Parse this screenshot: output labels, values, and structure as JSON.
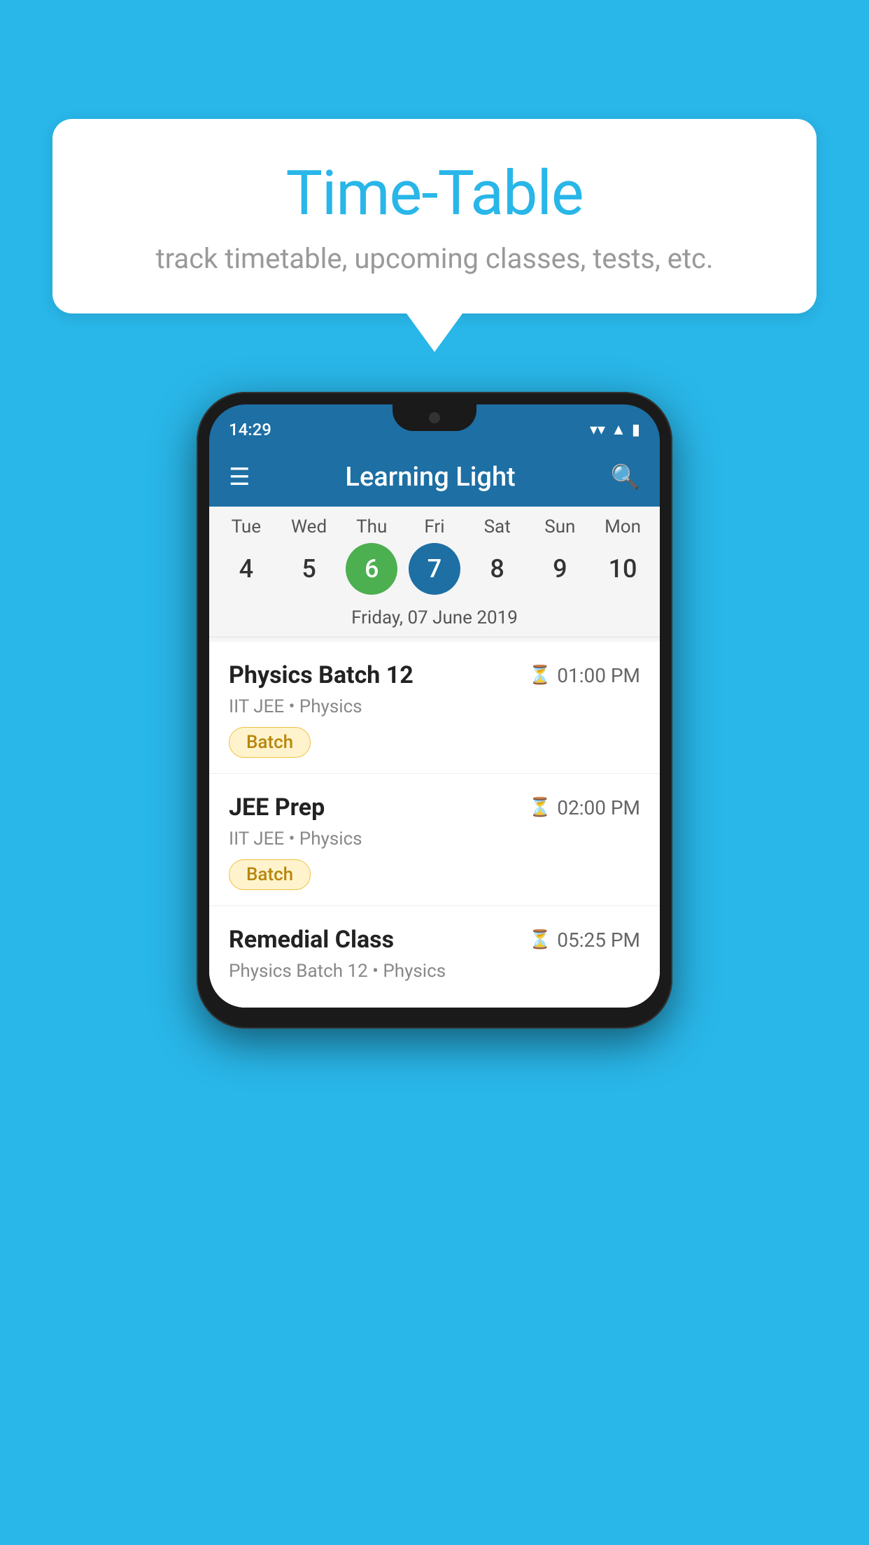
{
  "background_color": "#29B6E8",
  "speech_bubble": {
    "title": "Time-Table",
    "subtitle": "track timetable, upcoming classes, tests, etc."
  },
  "phone": {
    "status_bar": {
      "time": "14:29",
      "icons": [
        "wifi",
        "signal",
        "battery"
      ]
    },
    "app_bar": {
      "title": "Learning Light",
      "hamburger_label": "≡",
      "search_label": "🔍"
    },
    "calendar": {
      "days": [
        {
          "label": "Tue",
          "num": "4"
        },
        {
          "label": "Wed",
          "num": "5"
        },
        {
          "label": "Thu",
          "num": "6",
          "state": "today"
        },
        {
          "label": "Fri",
          "num": "7",
          "state": "selected"
        },
        {
          "label": "Sat",
          "num": "8"
        },
        {
          "label": "Sun",
          "num": "9"
        },
        {
          "label": "Mon",
          "num": "10"
        }
      ],
      "selected_date_label": "Friday, 07 June 2019"
    },
    "classes": [
      {
        "name": "Physics Batch 12",
        "time": "01:00 PM",
        "meta": "IIT JEE • Physics",
        "tag": "Batch"
      },
      {
        "name": "JEE Prep",
        "time": "02:00 PM",
        "meta": "IIT JEE • Physics",
        "tag": "Batch"
      },
      {
        "name": "Remedial Class",
        "time": "05:25 PM",
        "meta": "Physics Batch 12 • Physics",
        "tag": null
      }
    ]
  }
}
